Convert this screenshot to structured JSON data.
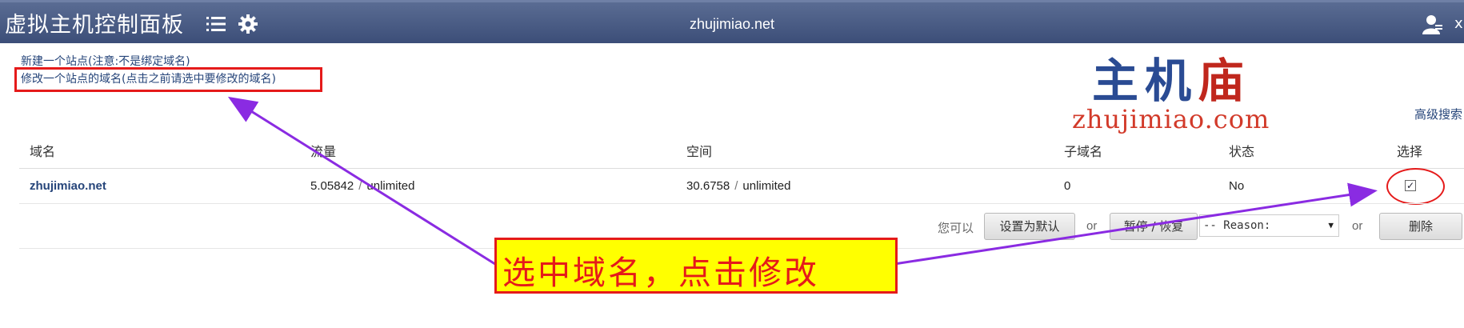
{
  "header": {
    "brand": "虚拟主机控制面板",
    "title": "zhujimiao.net",
    "user_trailing_text": "x"
  },
  "links": {
    "new_site": "新建一个站点(注意:不是绑定域名)",
    "edit_site_domain": "修改一个站点的域名(点击之前请选中要修改的域名)",
    "advanced_search": "高级搜索"
  },
  "logo": {
    "cn_chars": [
      "主",
      "机",
      "庙"
    ],
    "en": "zhujimiao.com"
  },
  "table": {
    "columns": [
      "域名",
      "流量",
      "空间",
      "子域名",
      "状态",
      "选择"
    ],
    "rows": [
      {
        "domain": "zhujimiao.net",
        "traffic_used": "5.05842",
        "traffic_limit": "unlimited",
        "space_used": "30.6758",
        "space_limit": "unlimited",
        "subdomains": "0",
        "status": "No",
        "selected": true
      }
    ],
    "separator": "/"
  },
  "actions": {
    "prefix": "您可以",
    "set_default": "设置为默认",
    "or": "or",
    "pause_resume": "暂停 / 恢复",
    "reason_select": "-- Reason:",
    "delete": "删除"
  },
  "annotation": {
    "text": "选中域名，点击修改"
  },
  "colors": {
    "header_bg": "#4a5c86",
    "link": "#26457a",
    "annotation_red": "#e51a1a",
    "annotation_yellow": "#ffff00",
    "arrow_purple": "#8a2be2"
  }
}
